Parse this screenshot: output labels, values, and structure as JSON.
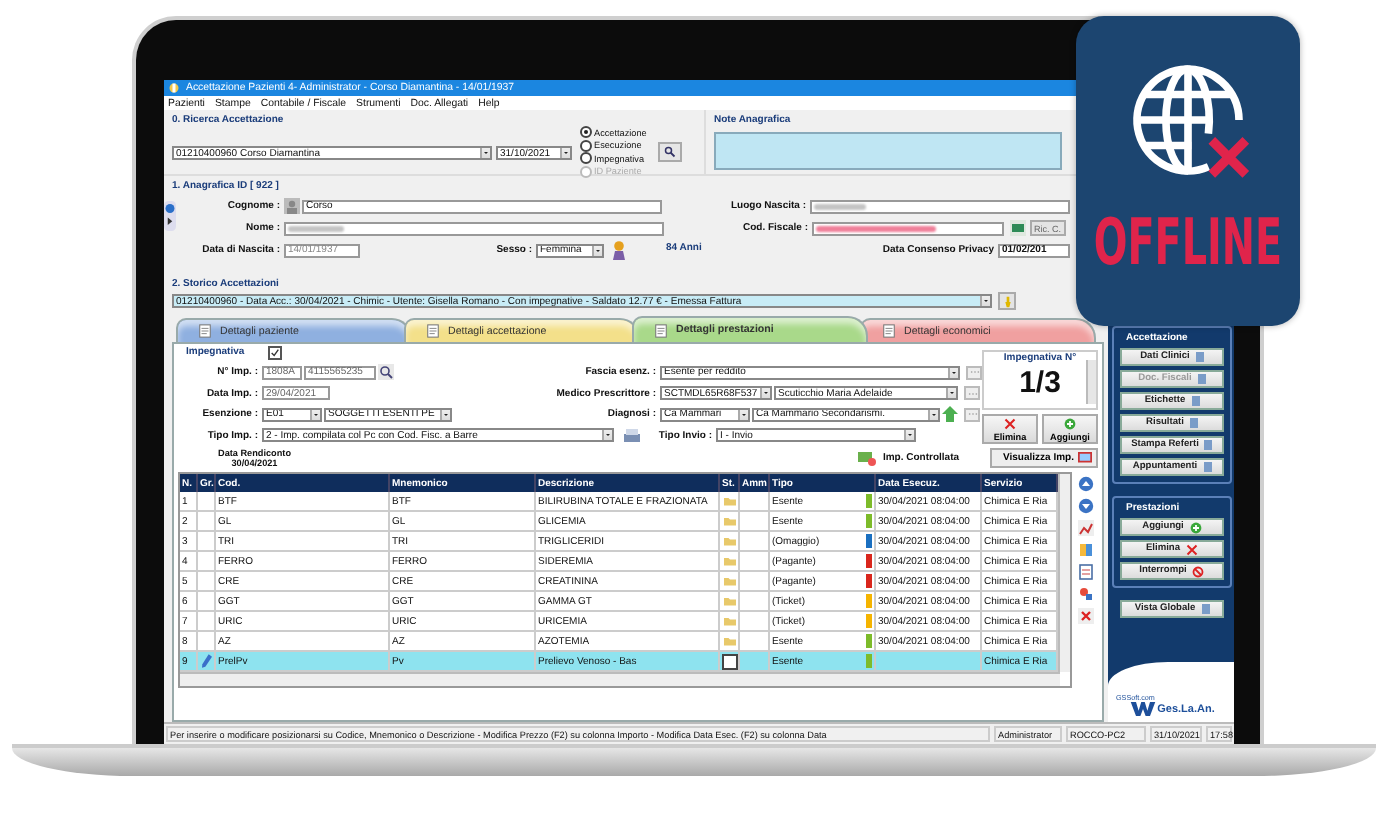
{
  "window": {
    "title": "Accettazione Pazienti 4- Administrator - Corso Diamantina - 14/01/1937"
  },
  "menu": [
    "Pazienti",
    "Stampe",
    "Contabile / Fiscale",
    "Strumenti",
    "Doc. Allegati",
    "Help"
  ],
  "search": {
    "title": "0. Ricerca Accettazione",
    "patient": "01210400960 Corso Diamantina",
    "date": "31/10/2021",
    "modes": [
      {
        "label": "Accettazione",
        "selected": true,
        "disabled": false
      },
      {
        "label": "Esecuzione",
        "selected": false,
        "disabled": false
      },
      {
        "label": "Impegnativa",
        "selected": false,
        "disabled": false
      },
      {
        "label": "ID Paziente",
        "selected": false,
        "disabled": true
      }
    ]
  },
  "notes": {
    "title": "Note Anagrafica"
  },
  "registry": {
    "title": "1. Anagrafica ID [ 922 ]",
    "surname_label": "Cognome :",
    "surname": "Corso",
    "name_label": "Nome :",
    "birth_date_label": "Data di Nascita :",
    "birth_date": "14/01/1937",
    "sex_label": "Sesso :",
    "sex": "Femmina",
    "birthplace_label": "Luogo Nascita :",
    "tax_code_label": "Cod. Fiscale :",
    "tax_code_button": "Ric. C.",
    "age": "84 Anni",
    "privacy_label": "Data Consenso Privacy",
    "privacy_date": "01/02/201"
  },
  "history": {
    "title": "2. Storico Accettazioni",
    "value": "01210400960 - Data Acc.: 30/04/2021 - Chimic - Utente: Gisella Romano - Con impegnative - Saldato 12.77 € - Emessa Fattura"
  },
  "tabs": [
    {
      "label": "Dettagli paziente",
      "selected": false,
      "color": "#8fb0e0"
    },
    {
      "label": "Dettagli accettazione",
      "selected": false,
      "color": "#f3e08a"
    },
    {
      "label": "Dettagli prestazioni",
      "selected": true,
      "color": "#a9d98a"
    },
    {
      "label": "Dettagli economici",
      "selected": false,
      "color": "#f0a0a0"
    }
  ],
  "prescription": {
    "title": "Impegnativa",
    "checked": true,
    "number_label": "N° Imp. :",
    "number_prefix": "1808A",
    "number": "4115565235",
    "date_label": "Data Imp. :",
    "date": "29/04/2021",
    "exemption_label": "Esenzione :",
    "exemption_code": "E01",
    "exemption": "SOGGETTI ESENTI PE",
    "type_label": "Tipo Imp. :",
    "type": "2 - Imp. compilata col Pc con Cod. Fisc. a Barre",
    "band_label": "Fascia esenz. :",
    "band": "Esente per reddito",
    "doctor_label": "Medico Prescrittore :",
    "doctor_code": "SCTMDL65R68F537",
    "doctor": "Scuticchio Maria Adelaide",
    "diagnosis_label": "Diagnosi :",
    "diagnosis_code": "Ca Mammari",
    "diagnosis": "Ca Mammario Secondarismi.",
    "send_label": "Tipo Invio :",
    "send": "I - Invio",
    "counter_title": "Impegnativa N°",
    "counter": "1/3",
    "delete": "Elimina",
    "add": "Aggiungi",
    "report_label": "Data Rendiconto",
    "report_date": "30/04/2021",
    "checked_label": "Imp. Controllata",
    "view": "Visualizza Imp."
  },
  "table": {
    "columns": [
      "N.",
      "Gr.",
      "Cod.",
      "Mnemonico",
      "Descrizione",
      "St.",
      "Amm",
      "Tipo",
      "Data Esecuz.",
      "Servizio"
    ],
    "rows": [
      {
        "n": "1",
        "code": "BTF",
        "mnemonic": "BTF",
        "description": "BILIRUBINA TOTALE E FRAZIONATA",
        "type": "Esente",
        "color": "#7dbb2a",
        "date": "30/04/2021 08:04:00",
        "service": "Chimica E Ria",
        "kind": "saved",
        "selected": false
      },
      {
        "n": "2",
        "code": "GL",
        "mnemonic": "GL",
        "description": "GLICEMIA",
        "type": "Esente",
        "color": "#7dbb2a",
        "date": "30/04/2021 08:04:00",
        "service": "Chimica E Ria",
        "kind": "saved",
        "selected": false
      },
      {
        "n": "3",
        "code": "TRI",
        "mnemonic": "TRI",
        "description": "TRIGLICERIDI",
        "type": "(Omaggio)",
        "color": "#1a6fc0",
        "date": "30/04/2021 08:04:00",
        "service": "Chimica E Ria",
        "kind": "saved",
        "selected": false
      },
      {
        "n": "4",
        "code": "FERRO",
        "mnemonic": "FERRO",
        "description": "SIDEREMIA",
        "type": "(Pagante)",
        "color": "#d9261c",
        "date": "30/04/2021 08:04:00",
        "service": "Chimica E Ria",
        "kind": "saved",
        "selected": false
      },
      {
        "n": "5",
        "code": "CRE",
        "mnemonic": "CRE",
        "description": "CREATININA",
        "type": "(Pagante)",
        "color": "#d9261c",
        "date": "30/04/2021 08:04:00",
        "service": "Chimica E Ria",
        "kind": "saved",
        "selected": false
      },
      {
        "n": "6",
        "code": "GGT",
        "mnemonic": "GGT",
        "description": "GAMMA GT",
        "type": "(Ticket)",
        "color": "#f5b400",
        "date": "30/04/2021 08:04:00",
        "service": "Chimica E Ria",
        "kind": "saved",
        "selected": false
      },
      {
        "n": "7",
        "code": "URIC",
        "mnemonic": "URIC",
        "description": "URICEMIA",
        "type": "(Ticket)",
        "color": "#f5b400",
        "date": "30/04/2021 08:04:00",
        "service": "Chimica E Ria",
        "kind": "saved",
        "selected": false
      },
      {
        "n": "8",
        "code": "AZ",
        "mnemonic": "AZ",
        "description": "AZOTEMIA",
        "type": "Esente",
        "color": "#7dbb2a",
        "date": "30/04/2021 08:04:00",
        "service": "Chimica E Ria",
        "kind": "saved",
        "selected": false
      },
      {
        "n": "9",
        "code": "PrelPv",
        "mnemonic": "Pv",
        "description": "Prelievo Venoso - Bas",
        "type": "Esente",
        "color": "#7dbb2a",
        "service": "Chimica E Ria",
        "kind": "new",
        "selected": true
      }
    ]
  },
  "side": {
    "admission_title": "Accettazione",
    "admission_buttons": [
      {
        "label": "Dati Clinici",
        "disabled": false
      },
      {
        "label": "Doc. Fiscali",
        "disabled": true
      },
      {
        "label": "Etichette",
        "disabled": false
      },
      {
        "label": "Risultati",
        "disabled": false
      },
      {
        "label": "Stampa Referti",
        "disabled": false
      },
      {
        "label": "Appuntamenti",
        "disabled": false
      }
    ],
    "services_title": "Prestazioni",
    "services_buttons": [
      {
        "label": "Aggiungi",
        "kind": "add"
      },
      {
        "label": "Elimina",
        "kind": "delete"
      },
      {
        "label": "Interrompi",
        "kind": "stop"
      }
    ],
    "global_view": "Vista Globale",
    "website": "GSSoft.com",
    "logo": "Ges.La.An."
  },
  "status_bar": {
    "hint": "Per inserire o modificare posizionarsi su Codice, Mnemonico o Descrizione - Modifica Prezzo (F2) su colonna Importo - Modifica Data Esec. (F2) su colonna Data",
    "user": "Administrator",
    "computer": "ROCCO-PC2",
    "date": "31/10/2021",
    "time": "17:58"
  },
  "badge": {
    "label": "OFFLINE"
  }
}
